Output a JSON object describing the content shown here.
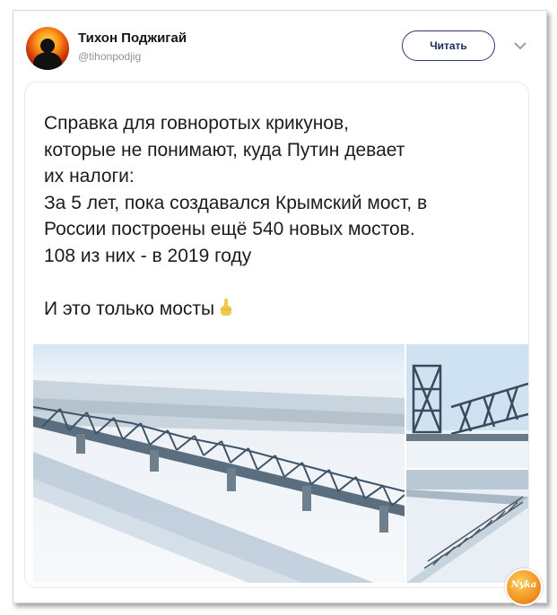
{
  "author": {
    "display_name": "Тихон Поджигай",
    "handle": "@tihonpodjig",
    "avatar_icon": "fire-silhouette-avatar"
  },
  "header": {
    "follow_label": "Читать",
    "menu_icon": "chevron-down-icon"
  },
  "tweet": {
    "text": "Справка для говноротых крикунов,\nкоторые не понимают, куда Путин девает\nих налоги:\nЗа 5 лет, пока создавался Крымский мост, в\nРоссии построены ещё 540 новых мостов.\n108 из них - в 2019 году\n\nИ это только мосты",
    "emoji": "pointing-up-hand-icon"
  },
  "media": {
    "images": [
      "aerial-winter-bridge-photo",
      "steel-truss-bridge-closeup-photo",
      "bridge-over-frozen-river-photo"
    ]
  },
  "watermark": {
    "text": "Nyka"
  },
  "colors": {
    "text": "#1c1c1c",
    "handle": "#8a949e",
    "follow_border": "#2a3a6a"
  }
}
